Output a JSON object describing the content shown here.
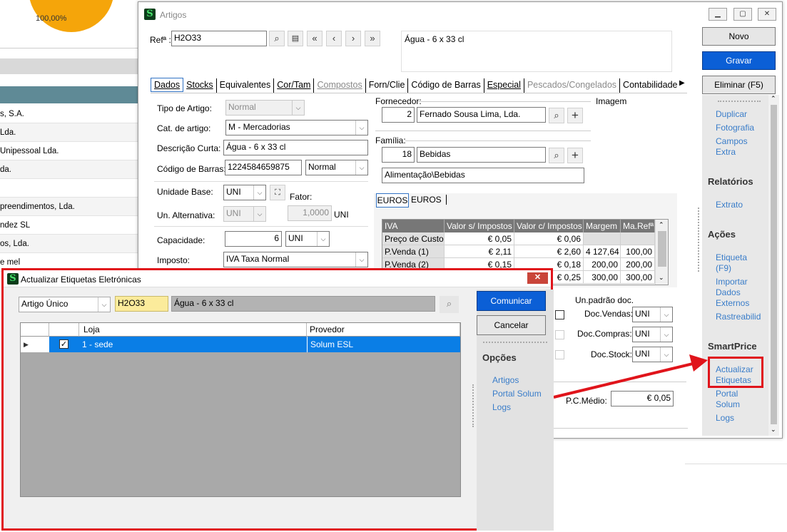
{
  "background": {
    "pie_percent": "100,00%",
    "rows": [
      "s, S.A.",
      "Lda.",
      "Unipessoal Lda.",
      "da.",
      "",
      "preendimentos, Lda.",
      "ndez SL",
      "os, Lda.",
      "e mel"
    ]
  },
  "artigos": {
    "title": "Artigos",
    "ref_label": "Refª :",
    "ref_value": "H2O33",
    "description": "Água - 6 x 33 cl",
    "tabs": [
      "Dados",
      "Stocks",
      "Equivalentes",
      "Cor/Tam",
      "Compostos",
      "Forn/Clie",
      "Código de Barras",
      "Especial",
      "Pescados/Congelados",
      "Contabilidade"
    ],
    "fields": {
      "tipo_label": "Tipo de Artigo:",
      "tipo_value": "Normal",
      "cat_label": "Cat. de artigo:",
      "cat_value": "M - Mercadorias",
      "desc_label": "Descrição Curta:",
      "desc_value": "Água - 6 x 33 cl",
      "barcode_label": "Código de Barras:",
      "barcode_value": "1224584659875",
      "barcode_type": "Normal",
      "unidade_label": "Unidade Base:",
      "unidade_value": "UNI",
      "fator_label": "Fator:",
      "alt_label": "Un. Alternativa:",
      "alt_value": "UNI",
      "fator_value": "1,0000",
      "fator_unit": "UNI",
      "cap_label": "Capacidade:",
      "cap_value": "6",
      "cap_unit": "UNI",
      "imposto_label": "Imposto:",
      "imposto_value": "IVA Taxa Normal"
    },
    "fornecedor": {
      "label": "Fornecedor:",
      "code": "2",
      "name": "Fernado Sousa Lima, Lda."
    },
    "imagem_label": "Imagem",
    "familia": {
      "label": "Família:",
      "code": "18",
      "name": "Bebidas",
      "path": "Alimentação\\Bebidas"
    },
    "price_tabs": [
      "EUROS",
      "EUROS"
    ],
    "price_grid": {
      "headers": [
        "IVA",
        "Valor s/ Impostos",
        "Valor c/ Impostos",
        "Margem",
        "Ma.Refª"
      ],
      "rows": [
        [
          "Preço de Custo",
          "€ 0,05",
          "€ 0,06",
          "",
          ""
        ],
        [
          "P.Venda (1)",
          "€ 2,11",
          "€ 2,60",
          "4 127,64",
          "100,00"
        ],
        [
          "P.Venda (2)",
          "€ 0,15",
          "€ 0,18",
          "200,00",
          "200,00"
        ],
        [
          "",
          "",
          "€ 0,25",
          "300,00",
          "300,00"
        ]
      ]
    },
    "unpadrao": {
      "label": "Un.padrão doc.",
      "vendas_label": "Doc.Vendas:",
      "vendas_value": "UNI",
      "compras_label": "Doc.Compras:",
      "compras_value": "UNI",
      "stock_label": "Doc.Stock:",
      "stock_value": "UNI"
    },
    "pcmedio_label": "P.C.Médio:",
    "pcmedio_value": "€ 0,05",
    "buttons": {
      "novo": "Novo",
      "gravar": "Gravar",
      "eliminar": "Eliminar (F5)"
    },
    "side": {
      "links1": [
        "Duplicar",
        "Fotografia",
        "Campos",
        "Extra"
      ],
      "relatorios": "Relatórios",
      "extrato": "Extrato",
      "acoes": "Ações",
      "acoes_links": [
        "Etiqueta",
        "(F9)",
        "Importar",
        "Dados",
        "Externos",
        "Rastreabilid"
      ],
      "smartprice": "SmartPrice",
      "sp_links": [
        "Actualizar",
        "Etiquetas",
        "Portal",
        "Solum",
        "Logs"
      ]
    }
  },
  "dialog": {
    "title": "Actualizar Etiquetas Eletrónicas",
    "mode": "Artigo Único",
    "ref": "H2O33",
    "desc": "Água - 6 x 33 cl",
    "grid_headers": [
      "Loja",
      "Provedor"
    ],
    "grid_row": {
      "loja": "1 - sede",
      "provedor": "Solum ESL"
    },
    "comunicar": "Comunicar",
    "cancelar": "Cancelar",
    "opcoes": "Opções",
    "links": [
      "Artigos",
      "Portal Solum",
      "Logs"
    ]
  }
}
